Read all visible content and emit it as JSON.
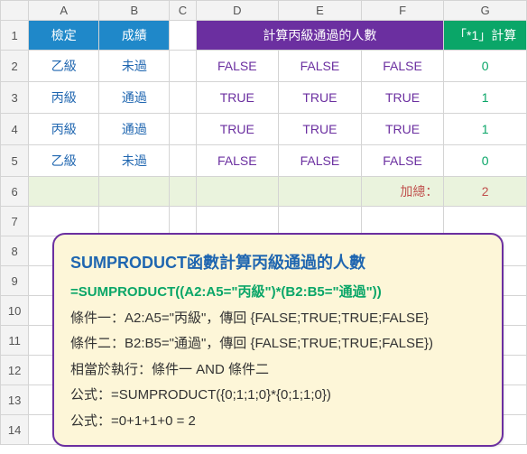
{
  "columns": [
    "",
    "A",
    "B",
    "C",
    "D",
    "E",
    "F",
    "G"
  ],
  "rows": [
    "1",
    "2",
    "3",
    "4",
    "5",
    "6",
    "7",
    "8",
    "9",
    "10",
    "11",
    "12",
    "13",
    "14"
  ],
  "header": {
    "A": "檢定",
    "B": "成績",
    "DEF": "計算丙級通過的人數",
    "G": "「*1」計算"
  },
  "data_rows": [
    {
      "A": "乙級",
      "B": "未過",
      "D": "FALSE",
      "E": "FALSE",
      "F": "FALSE",
      "G": "0"
    },
    {
      "A": "丙級",
      "B": "通過",
      "D": "TRUE",
      "E": "TRUE",
      "F": "TRUE",
      "G": "1"
    },
    {
      "A": "丙級",
      "B": "通過",
      "D": "TRUE",
      "E": "TRUE",
      "F": "TRUE",
      "G": "1"
    },
    {
      "A": "乙級",
      "B": "未過",
      "D": "FALSE",
      "E": "FALSE",
      "F": "FALSE",
      "G": "0"
    }
  ],
  "sum_row": {
    "label": "加總：",
    "value": "2"
  },
  "annotation": {
    "title": "SUMPRODUCT函數計算丙級通過的人數",
    "formula": "=SUMPRODUCT((A2:A5=\"丙級\")*(B2:B5=\"通過\"))",
    "line1": "條件一：A2:A5=\"丙級\"，傳回 {FALSE;TRUE;TRUE;FALSE}",
    "line2": "條件二：B2:B5=\"通過\"，傳回 {FALSE;TRUE;TRUE;FALSE})",
    "line3": "相當於執行：條件一 AND 條件二",
    "line4": "公式：=SUMPRODUCT({0;1;1;0}*{0;1;1;0})",
    "line5": "公式：=0+1+1+0 = 2"
  },
  "chart_data": {
    "type": "table",
    "title": "計算丙級通過的人數",
    "columns": [
      "檢定",
      "成績",
      "D",
      "E",
      "F",
      "「*1」計算"
    ],
    "rows": [
      [
        "乙級",
        "未過",
        "FALSE",
        "FALSE",
        "FALSE",
        0
      ],
      [
        "丙級",
        "通過",
        "TRUE",
        "TRUE",
        "TRUE",
        1
      ],
      [
        "丙級",
        "通過",
        "TRUE",
        "TRUE",
        "TRUE",
        1
      ],
      [
        "乙級",
        "未過",
        "FALSE",
        "FALSE",
        "FALSE",
        0
      ]
    ],
    "total": 2
  }
}
